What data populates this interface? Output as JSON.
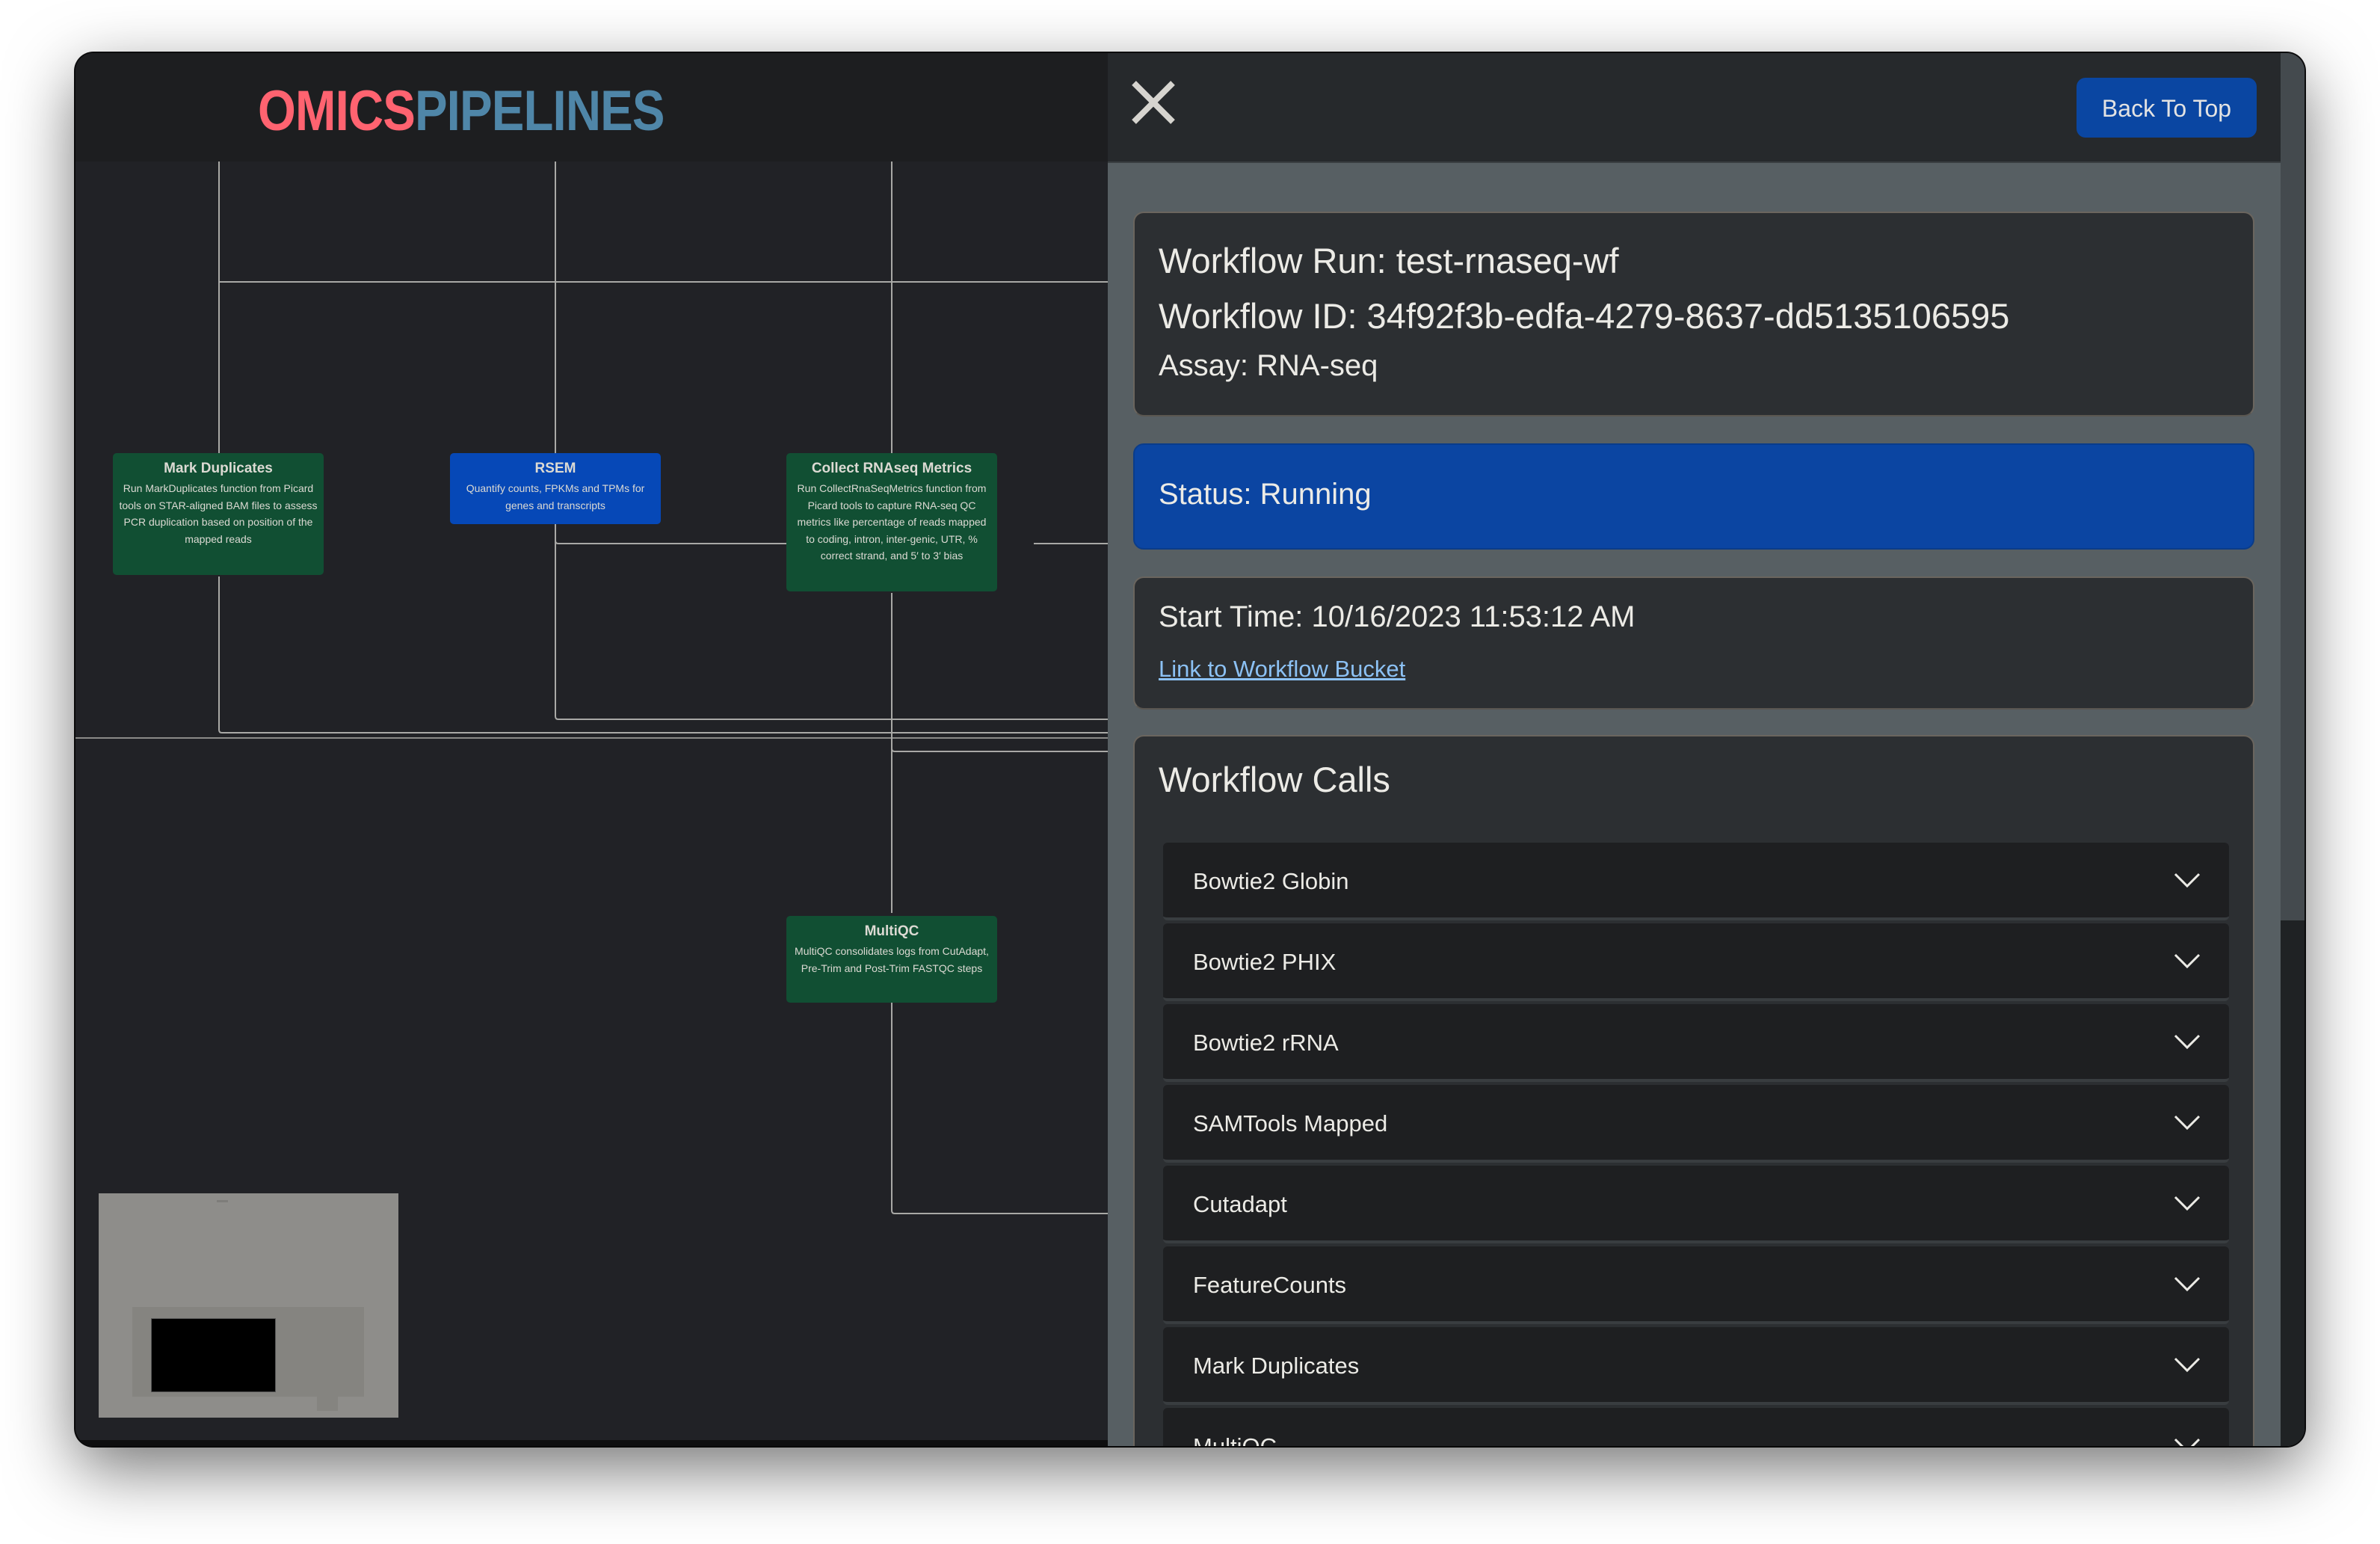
{
  "app": {
    "logo_part1": "OMICS",
    "logo_part2": "PIPELINES",
    "brand_colors": {
      "omics": "#ff6370",
      "pipelines": "#4f86a8"
    }
  },
  "graph": {
    "nodes": [
      {
        "title": "Mark Duplicates",
        "description": "Run MarkDuplicates function from Picard tools on STAR-aligned BAM files to assess PCR duplication based on position of the mapped reads",
        "status_color": "#114f33"
      },
      {
        "title": "RSEM",
        "description": "Quantify counts, FPKMs and TPMs for genes and transcripts",
        "status_color": "#0648b7"
      },
      {
        "title": "Collect RNAseq Metrics",
        "description": "Run CollectRnaSeqMetrics function from Picard tools to capture RNA-seq QC metrics like percentage of reads mapped to coding, intron, inter-genic, UTR, % correct strand, and 5′ to 3′ bias",
        "status_color": "#114f33"
      },
      {
        "title": "MultiQC",
        "description": "MultiQC consolidates logs from CutAdapt, Pre-Trim and Post-Trim FASTQC steps",
        "status_color": "#114f33"
      }
    ]
  },
  "panel": {
    "close_icon": "close-icon",
    "back_to_top_label": "Back To Top",
    "workflow_run": "Workflow Run: test-rnaseq-wf",
    "workflow_id": "Workflow ID: 34f92f3b-edfa-4279-8637-dd5135106595",
    "assay": "Assay: RNA-seq",
    "status": "Status: Running",
    "status_color": "#0b45a2",
    "start_time": "Start Time: 10/16/2023 11:53:12 AM",
    "bucket_link": "Link to Workflow Bucket",
    "calls_heading": "Workflow Calls",
    "calls": [
      {
        "label": "Bowtie2 Globin"
      },
      {
        "label": "Bowtie2 PHIX"
      },
      {
        "label": "Bowtie2 rRNA"
      },
      {
        "label": "SAMTools Mapped"
      },
      {
        "label": "Cutadapt"
      },
      {
        "label": "FeatureCounts"
      },
      {
        "label": "Mark Duplicates"
      },
      {
        "label": "MultiQC"
      }
    ]
  }
}
